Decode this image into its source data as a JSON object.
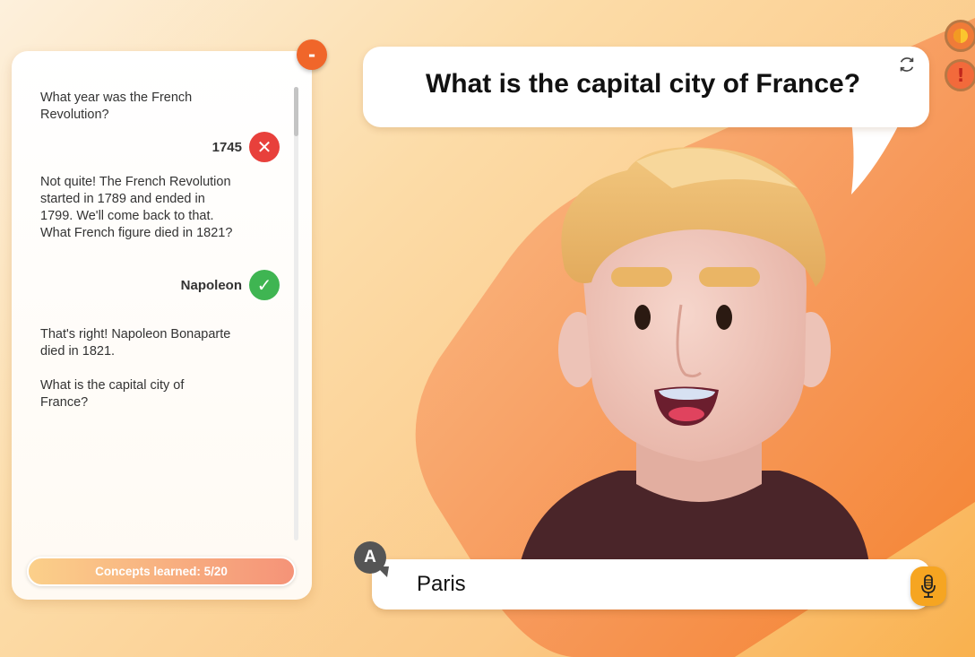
{
  "chat": {
    "messages": [
      {
        "role": "tutor",
        "text": "What year was the French Revolution?"
      },
      {
        "role": "student",
        "text": "1745",
        "status": "wrong",
        "status_icon": "close-icon"
      },
      {
        "role": "tutor",
        "text": "Not quite! The French Revolution started in 1789 and ended in 1799. We'll come back to that. What French figure died in 1821?"
      },
      {
        "role": "student",
        "text": "Napoleon",
        "status": "correct",
        "status_icon": "check-icon"
      },
      {
        "role": "tutor",
        "text": "That's right! Napoleon Bonaparte died in 1821."
      },
      {
        "role": "tutor",
        "text": "What is the capital city of France?"
      }
    ],
    "collapse_label": "-",
    "progress_label": "Concepts learned: 5/20",
    "progress": {
      "learned": 5,
      "total": 20
    }
  },
  "bubble": {
    "question": "What is the capital city of France?"
  },
  "answer": {
    "value": "Paris",
    "user_initial": "A"
  },
  "corner": {
    "report_label": "!"
  },
  "colors": {
    "accent": "#f0662a",
    "correct": "#3fb552",
    "wrong": "#e8403b",
    "mic": "#f6a521"
  }
}
